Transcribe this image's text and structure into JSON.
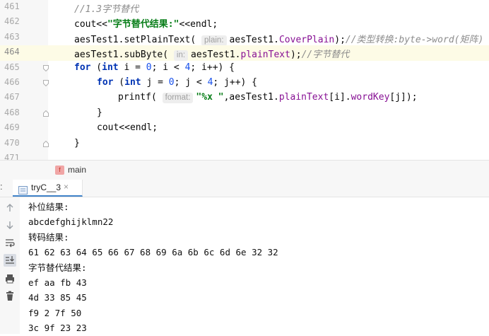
{
  "editor": {
    "lines": [
      {
        "num": "461",
        "segments": [
          {
            "cls": "cm",
            "text": "//1.3字节替代"
          }
        ]
      },
      {
        "num": "462",
        "segments": [
          {
            "cls": "",
            "text": "cout<<"
          },
          {
            "cls": "str",
            "text": "\"字节替代结果:\""
          },
          {
            "cls": "",
            "text": "<<endl;"
          }
        ]
      },
      {
        "num": "463",
        "segments": [
          {
            "cls": "",
            "text": "aesTest1.setPlainText( "
          },
          {
            "cls": "hint",
            "text": "plain:"
          },
          {
            "cls": "",
            "text": "aesTest1."
          },
          {
            "cls": "fld",
            "text": "CoverPlain"
          },
          {
            "cls": "",
            "text": ");"
          },
          {
            "cls": "cm",
            "text": "//类型转换:byte->word(矩阵)"
          }
        ]
      },
      {
        "num": "464",
        "segments": [
          {
            "cls": "",
            "text": "aesTest1.subByte( "
          },
          {
            "cls": "hint",
            "text": "in:"
          },
          {
            "cls": "",
            "text": "aesTest1."
          },
          {
            "cls": "fld",
            "text": "plainText"
          },
          {
            "cls": "",
            "text": ");"
          },
          {
            "cls": "cm",
            "text": "//字节替代"
          }
        ]
      },
      {
        "num": "465",
        "segments": [
          {
            "cls": "kw",
            "text": "for"
          },
          {
            "cls": "",
            "text": " ("
          },
          {
            "cls": "kw",
            "text": "int"
          },
          {
            "cls": "",
            "text": " i = "
          },
          {
            "cls": "num",
            "text": "0"
          },
          {
            "cls": "",
            "text": "; i < "
          },
          {
            "cls": "num",
            "text": "4"
          },
          {
            "cls": "",
            "text": "; i++) {"
          }
        ]
      },
      {
        "num": "466",
        "segments": [
          {
            "cls": "kw",
            "text": "for"
          },
          {
            "cls": "",
            "text": " ("
          },
          {
            "cls": "kw",
            "text": "int"
          },
          {
            "cls": "",
            "text": " j = "
          },
          {
            "cls": "num",
            "text": "0"
          },
          {
            "cls": "",
            "text": "; j < "
          },
          {
            "cls": "num",
            "text": "4"
          },
          {
            "cls": "",
            "text": "; j++) {"
          }
        ]
      },
      {
        "num": "467",
        "segments": [
          {
            "cls": "",
            "text": "printf( "
          },
          {
            "cls": "hint",
            "text": "format:"
          },
          {
            "cls": "str",
            "text": "\"%x \""
          },
          {
            "cls": "",
            "text": ",aesTest1."
          },
          {
            "cls": "fld",
            "text": "plainText"
          },
          {
            "cls": "",
            "text": "[i]."
          },
          {
            "cls": "fld",
            "text": "wordKey"
          },
          {
            "cls": "",
            "text": "[j]);"
          }
        ]
      },
      {
        "num": "468",
        "segments": [
          {
            "cls": "",
            "text": "}"
          }
        ]
      },
      {
        "num": "469",
        "segments": [
          {
            "cls": "",
            "text": "cout<<endl;"
          }
        ]
      },
      {
        "num": "470",
        "segments": [
          {
            "cls": "",
            "text": "}"
          }
        ]
      },
      {
        "num": "471",
        "segments": []
      }
    ]
  },
  "status": {
    "function_name": "main",
    "function_icon": "f"
  },
  "run_panel": {
    "lead_char": ":",
    "tab_label": "tryC__3",
    "tab_close": "×",
    "tools": [
      "up-arrow-icon",
      "down-arrow-icon",
      "soft-wrap-icon",
      "scroll-to-end-icon",
      "print-icon",
      "trash-icon"
    ],
    "output": [
      "补位结果:",
      "abcdefghijklmn22",
      "转码结果:",
      "61 62 63 64 65 66 67 68 69 6a 6b 6c 6d 6e 32 32",
      "字节替代结果:",
      "ef aa fb 43",
      "4d 33 85 45",
      "f9 2 7f 50",
      "3c 9f 23 23"
    ]
  }
}
